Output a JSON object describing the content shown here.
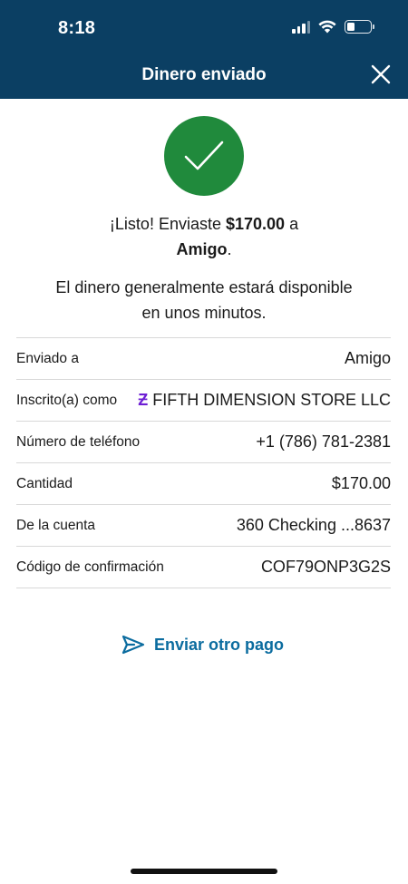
{
  "status_bar": {
    "time": "8:18",
    "icons": [
      "signal-icon",
      "wifi-icon",
      "battery-icon"
    ]
  },
  "header": {
    "title": "Dinero enviado",
    "close_icon": "close-icon",
    "background_color": "#0b3f63"
  },
  "success": {
    "icon": "check-icon",
    "color": "#208a3c",
    "line1_prefix": "¡Listo! Enviaste ",
    "amount": "$170.00",
    "line1_suffix": " a",
    "recipient": "Amigo",
    "line2_suffix": ".",
    "availability_line1": "El dinero generalmente estará disponible",
    "availability_line2": "en unos minutos."
  },
  "details": [
    {
      "label": "Enviado a",
      "value": "Amigo"
    },
    {
      "label": "Inscrito(a) como",
      "value": "FIFTH DIMENSION STORE LLC",
      "icon": "zelle-icon"
    },
    {
      "label": "Número de teléfono",
      "value": "+1 (786) 781-2381"
    },
    {
      "label": "Cantidad",
      "value": "$170.00"
    },
    {
      "label": "De la cuenta",
      "value": "360 Checking ...8637"
    },
    {
      "label": "Código de confirmación",
      "value": "COF79ONP3G2S"
    }
  ],
  "actions": {
    "send_again_label": "Enviar otro pago",
    "send_again_icon": "send-icon",
    "accent_color": "#0b6c9f"
  }
}
